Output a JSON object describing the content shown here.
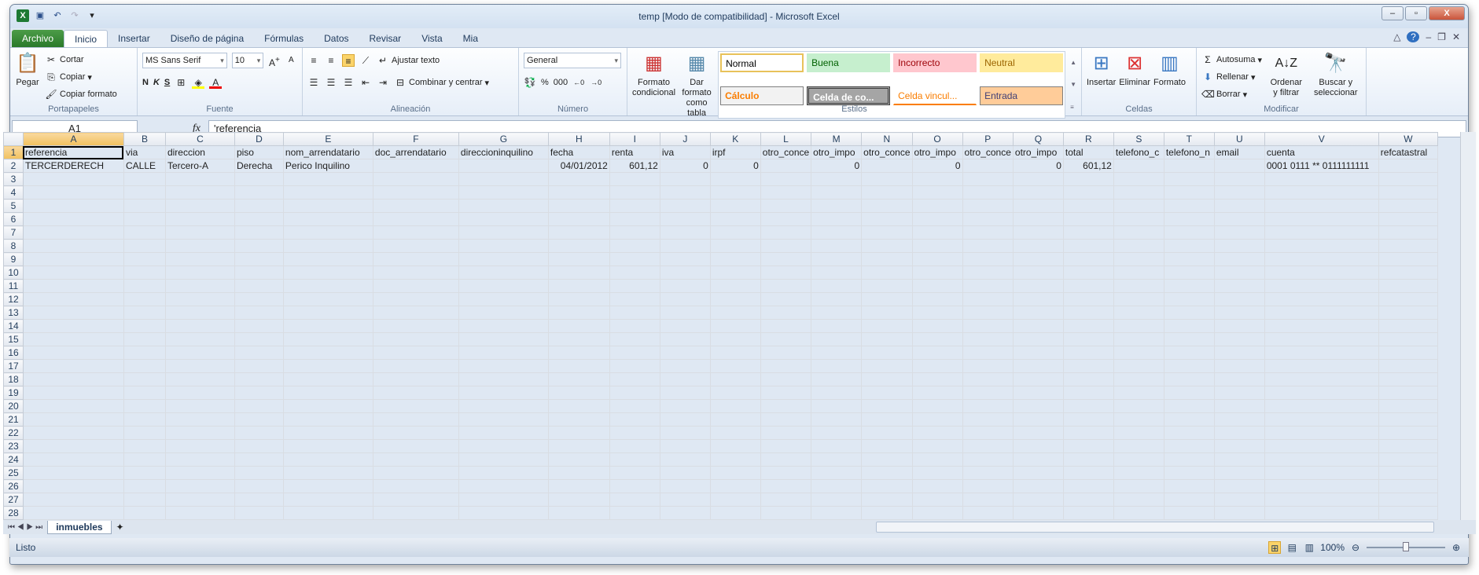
{
  "window": {
    "title": "temp  [Modo de compatibilidad]  -  Microsoft Excel"
  },
  "tabs": [
    "Archivo",
    "Inicio",
    "Insertar",
    "Diseño de página",
    "Fórmulas",
    "Datos",
    "Revisar",
    "Vista",
    "Mia"
  ],
  "ribbon": {
    "portapapeles": {
      "label": "Portapapeles",
      "pegar": "Pegar",
      "cortar": "Cortar",
      "copiar": "Copiar",
      "copiar_formato": "Copiar formato"
    },
    "fuente": {
      "label": "Fuente",
      "font": "MS Sans Serif",
      "size": "10",
      "bold": "N",
      "italic": "K",
      "underline": "S"
    },
    "alineacion": {
      "label": "Alineación",
      "ajustar": "Ajustar texto",
      "combinar": "Combinar y centrar"
    },
    "numero": {
      "label": "Número",
      "format": "General",
      "percent": "%",
      "thousands": "000"
    },
    "estilos": {
      "label": "Estilos",
      "formato_condicional": "Formato condicional",
      "dar_formato": "Dar formato como tabla",
      "cells": [
        {
          "name": "Normal",
          "bg": "#ffffff",
          "fg": "#000000"
        },
        {
          "name": "Buena",
          "bg": "#c6efce",
          "fg": "#006100"
        },
        {
          "name": "Incorrecto",
          "bg": "#ffc7ce",
          "fg": "#9c0006"
        },
        {
          "name": "Neutral",
          "bg": "#ffeb9c",
          "fg": "#9c6500"
        },
        {
          "name": "Cálculo",
          "bg": "#f2f2f2",
          "fg": "#fa7d00"
        },
        {
          "name": "Celda de co...",
          "bg": "#a5a5a5",
          "fg": "#ffffff"
        },
        {
          "name": "Celda vincul...",
          "bg": "#ffffff",
          "fg": "#fa7d00"
        },
        {
          "name": "Entrada",
          "bg": "#ffcc99",
          "fg": "#3f3f76"
        }
      ]
    },
    "celdas": {
      "label": "Celdas",
      "insertar": "Insertar",
      "eliminar": "Eliminar",
      "formato": "Formato"
    },
    "modificar": {
      "label": "Modificar",
      "autosuma": "Autosuma",
      "rellenar": "Rellenar",
      "borrar": "Borrar",
      "ordenar": "Ordenar y filtrar",
      "buscar": "Buscar y seleccionar"
    }
  },
  "formula_bar": {
    "name_box": "A1",
    "fx": "fx",
    "formula": "'referencia"
  },
  "grid": {
    "columns": [
      "A",
      "B",
      "C",
      "D",
      "E",
      "F",
      "G",
      "H",
      "I",
      "J",
      "K",
      "L",
      "M",
      "N",
      "O",
      "P",
      "Q",
      "R",
      "S",
      "T",
      "U",
      "V",
      "W"
    ],
    "rows": [
      [
        "referencia",
        "via",
        "direccion",
        "piso",
        "nom_arrendatario",
        "doc_arrendatario",
        "direccioninquilino",
        "fecha",
        "renta",
        "iva",
        "irpf",
        "otro_conce",
        "otro_impo",
        "otro_conce",
        "otro_impo",
        "otro_conce",
        "otro_impo",
        "total",
        "telefono_c",
        "telefono_n",
        "email",
        "cuenta",
        "refcatastral"
      ],
      [
        "TERCERDERECH",
        "CALLE",
        "Tercero-A",
        "Derecha",
        "Perico Inquilino",
        "",
        "",
        "04/01/2012",
        "601,12",
        "0",
        "0",
        "",
        "0",
        "",
        "0",
        "",
        "0",
        "601,12",
        "",
        "",
        "",
        "0001 0111 ** 0111111111",
        ""
      ]
    ],
    "row_count": 28,
    "selected_cell": "A1"
  },
  "sheets": [
    "inmuebles"
  ],
  "status": {
    "text": "Listo",
    "zoom": "100%"
  }
}
